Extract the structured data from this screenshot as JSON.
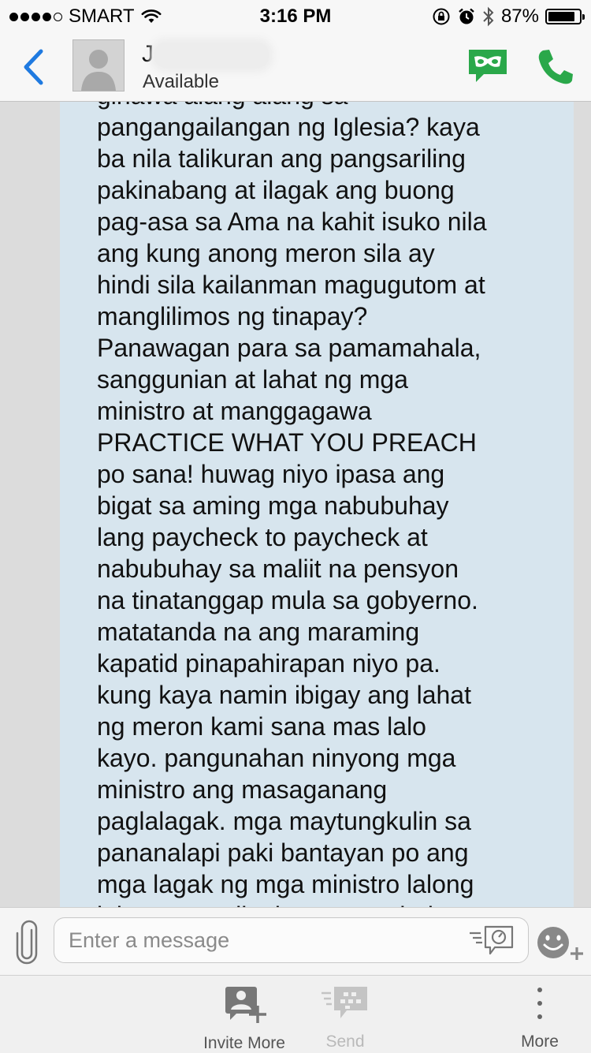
{
  "status_bar": {
    "carrier": "SMART",
    "time": "3:16 PM",
    "battery": "87%",
    "battery_level": 0.87
  },
  "header": {
    "contact_name": "J.",
    "contact_status": "Available",
    "colors": {
      "accent": "#1f7ae0",
      "bbm_green": "#2aa84a"
    }
  },
  "message": {
    "text": "gihawa alang alang sa\npangangailangan ng Iglesia? kaya\nba nila talikuran ang pangsariling\npakinabang at ilagak ang buong\npag-asa sa Ama na kahit isuko nila\nang kung anong meron sila ay\nhindi sila kailanman magugutom at\nmanglilimos ng tinapay?\nPanawagan para sa pamamahala,\nsanggunian at lahat ng mga\nministro at manggagawa\nPRACTICE WHAT YOU PREACH\npo sana! huwag niyo ipasa ang\nbigat sa aming mga nabubuhay\nlang paycheck to paycheck at\nnabubuhay sa maliit na pensyon\nna tinatanggap mula sa gobyerno.\nmatatanda na ang maraming\nkapatid pinapahirapan niyo pa.\nkung kaya namin ibigay ang lahat\nng meron kami sana mas lalo\nkayo. pangunahan ninyong mga\nministro ang masaganang\npaglalagak. mga maytungkulin sa\npananalapi paki bantayan po ang\nmga lagak ng mga ministro lalong\nlalo na ang distrito at pamahalaan",
    "bubble_color": "#d7e5ee"
  },
  "compose": {
    "placeholder": "Enter a message"
  },
  "toolbar": {
    "invite_label": "Invite More",
    "send_label": "Send",
    "more_label": "More"
  }
}
